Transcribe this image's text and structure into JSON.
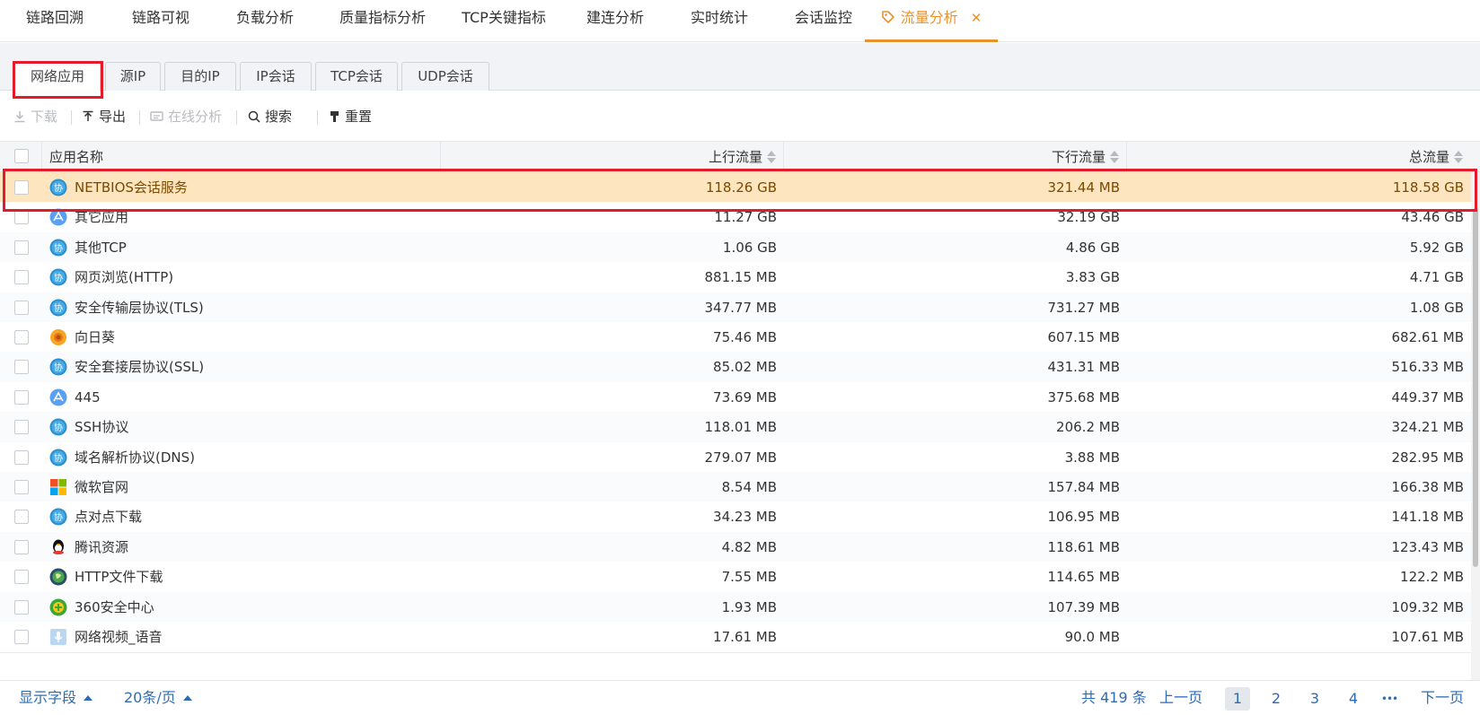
{
  "top_tabs": [
    {
      "label": "链路回溯"
    },
    {
      "label": "链路可视"
    },
    {
      "label": "负载分析"
    },
    {
      "label": "质量指标分析"
    },
    {
      "label": "TCP关键指标"
    },
    {
      "label": "建连分析"
    },
    {
      "label": "实时统计"
    },
    {
      "label": "会话监控"
    },
    {
      "label": "流量分析",
      "active": true,
      "close": "✕"
    }
  ],
  "sub_tabs": [
    {
      "label": "网络应用",
      "active": true
    },
    {
      "label": "源IP"
    },
    {
      "label": "目的IP"
    },
    {
      "label": "IP会话"
    },
    {
      "label": "TCP会话"
    },
    {
      "label": "UDP会话"
    }
  ],
  "toolbar": {
    "download": "下载",
    "export": "导出",
    "online_analysis": "在线分析",
    "search": "搜索",
    "reset": "重置"
  },
  "table": {
    "headers": {
      "name": "应用名称",
      "up": "上行流量",
      "down": "下行流量",
      "total": "总流量"
    },
    "rows": [
      {
        "icon": "protocol-icon",
        "name": "NETBIOS会话服务",
        "up": "118.26 GB",
        "down": "321.44 MB",
        "total": "118.58 GB",
        "selected": true
      },
      {
        "icon": "app-store-icon",
        "name": "其它应用",
        "up": "11.27 GB",
        "down": "32.19 GB",
        "total": "43.46 GB"
      },
      {
        "icon": "protocol-icon",
        "name": "其他TCP",
        "up": "1.06 GB",
        "down": "4.86 GB",
        "total": "5.92 GB"
      },
      {
        "icon": "protocol-icon",
        "name": "网页浏览(HTTP)",
        "up": "881.15 MB",
        "down": "3.83 GB",
        "total": "4.71 GB"
      },
      {
        "icon": "protocol-icon",
        "name": "安全传输层协议(TLS)",
        "up": "347.77 MB",
        "down": "731.27 MB",
        "total": "1.08 GB"
      },
      {
        "icon": "sunflower-icon",
        "name": "向日葵",
        "up": "75.46 MB",
        "down": "607.15 MB",
        "total": "682.61 MB"
      },
      {
        "icon": "protocol-icon",
        "name": "安全套接层协议(SSL)",
        "up": "85.02 MB",
        "down": "431.31 MB",
        "total": "516.33 MB"
      },
      {
        "icon": "app-store-icon",
        "name": "445",
        "up": "73.69 MB",
        "down": "375.68 MB",
        "total": "449.37 MB"
      },
      {
        "icon": "protocol-icon",
        "name": "SSH协议",
        "up": "118.01 MB",
        "down": "206.2 MB",
        "total": "324.21 MB"
      },
      {
        "icon": "protocol-icon",
        "name": "域名解析协议(DNS)",
        "up": "279.07 MB",
        "down": "3.88 MB",
        "total": "282.95 MB"
      },
      {
        "icon": "windows-icon",
        "name": "微软官网",
        "up": "8.54 MB",
        "down": "157.84 MB",
        "total": "166.38 MB"
      },
      {
        "icon": "protocol-icon",
        "name": "点对点下载",
        "up": "34.23 MB",
        "down": "106.95 MB",
        "total": "141.18 MB"
      },
      {
        "icon": "qq-penguin-icon",
        "name": "腾讯资源",
        "up": "4.82 MB",
        "down": "118.61 MB",
        "total": "123.43 MB"
      },
      {
        "icon": "globe-download-icon",
        "name": "HTTP文件下载",
        "up": "7.55 MB",
        "down": "114.65 MB",
        "total": "122.2 MB"
      },
      {
        "icon": "shield-360-icon",
        "name": "360安全中心",
        "up": "1.93 MB",
        "down": "107.39 MB",
        "total": "109.32 MB"
      },
      {
        "icon": "microphone-icon",
        "name": "网络视频_语音",
        "up": "17.61 MB",
        "down": "90.0 MB",
        "total": "107.61 MB"
      }
    ]
  },
  "footer": {
    "display_fields": "显示字段",
    "page_size": "20条/页",
    "total": "共 419 条",
    "prev": "上一页",
    "pages": [
      "1",
      "2",
      "3",
      "4"
    ],
    "current_page": "1",
    "ellipsis": "•••",
    "next": "下一页"
  },
  "colors": {
    "accent": "#e8932b",
    "highlight_row": "#fde5c0",
    "annotation_red": "#e21c2b",
    "link_blue": "#2d6cb5"
  }
}
